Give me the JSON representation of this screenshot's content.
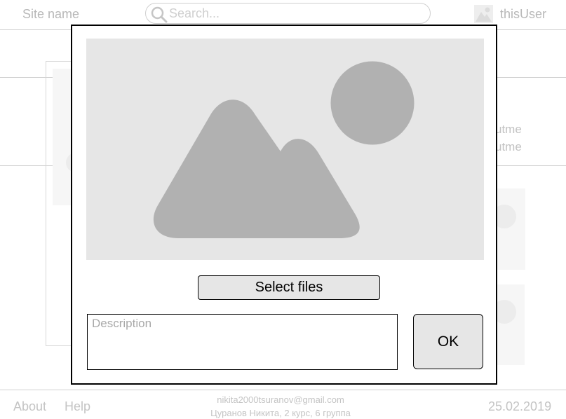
{
  "header": {
    "site_name": "Site name",
    "search_placeholder": "Search...",
    "user_name": "thisUser"
  },
  "background": {
    "text_line_1": "utme",
    "text_line_2": "utme"
  },
  "footer": {
    "about_label": "About",
    "help_label": "Help",
    "email": "nikita2000tsuranov@gmail.com",
    "author": "Цуранов Никита, 2 курс, 6 группа",
    "date": "25.02.2019"
  },
  "modal": {
    "select_files_label": "Select files",
    "description_placeholder": "Description",
    "description_value": "",
    "ok_label": "OK"
  },
  "icons": {
    "search": "search-icon",
    "avatar": "user-avatar-icon",
    "image_placeholder": "image-placeholder-icon"
  },
  "colors": {
    "modal_border": "#000000",
    "placeholder_fill": "#e6e6e6",
    "placeholder_shape": "#b1b1b1",
    "faded_text": "#b8b8b8"
  }
}
